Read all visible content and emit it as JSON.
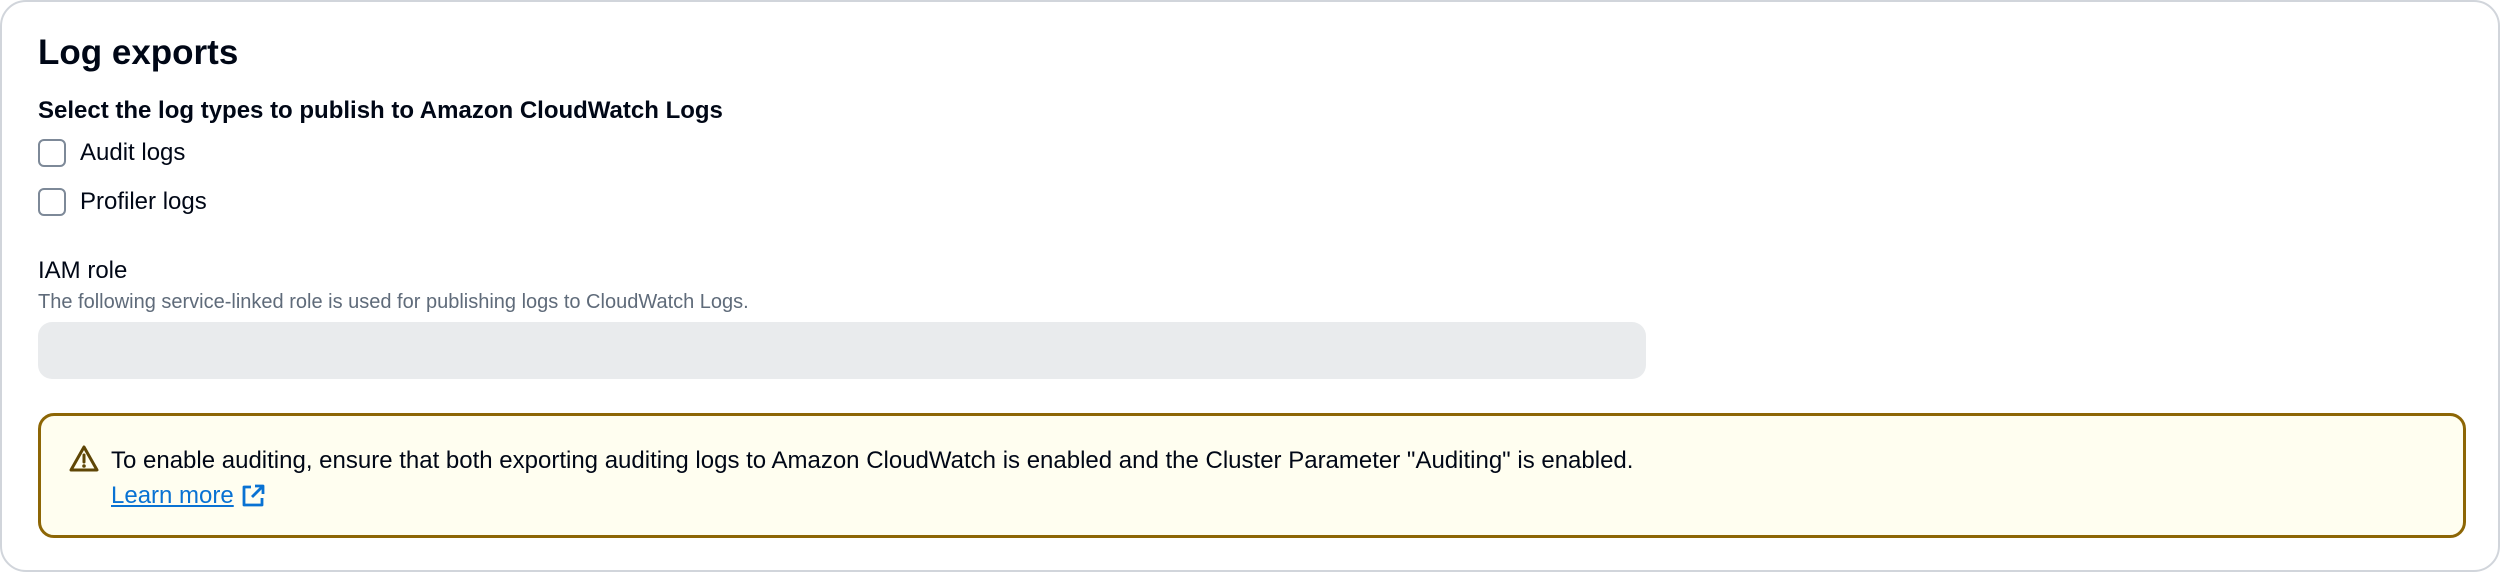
{
  "section": {
    "title": "Log exports",
    "group_label": "Select the log types to publish to Amazon CloudWatch Logs",
    "log_types": [
      {
        "label": "Audit logs",
        "checked": false
      },
      {
        "label": "Profiler logs",
        "checked": false
      }
    ]
  },
  "iam_role": {
    "label": "IAM role",
    "description": "The following service-linked role is used for publishing logs to CloudWatch Logs.",
    "value": ""
  },
  "alert": {
    "type": "warning",
    "icon": "warning-icon",
    "message": "To enable auditing, ensure that both exporting auditing logs to Amazon CloudWatch is enabled and the Cluster Parameter \"Auditing\" is enabled.",
    "link_label": "Learn more",
    "link_icon": "external-link-icon"
  },
  "colors": {
    "warning_border": "#8d6605",
    "warning_background": "#fffef0",
    "link": "#0972d3",
    "disabled_input": "#e9ebed",
    "secondary_text": "#5f6b7a"
  }
}
